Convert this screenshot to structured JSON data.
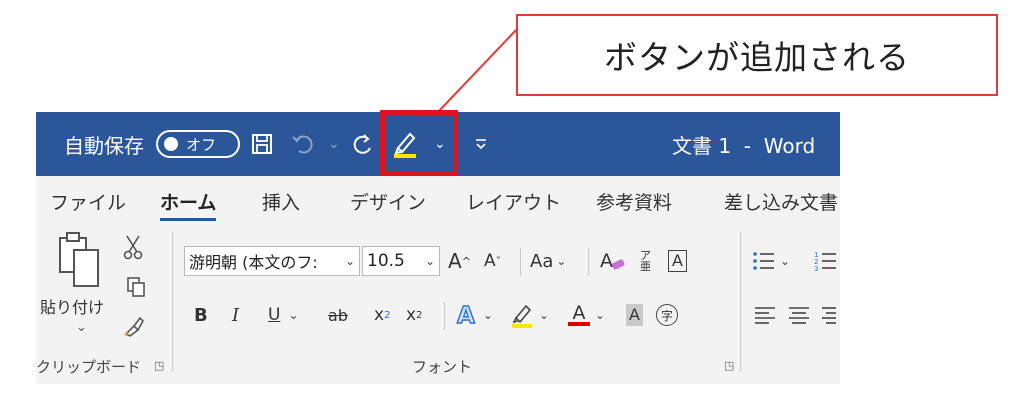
{
  "callout": {
    "text": "ボタンが追加される"
  },
  "titlebar": {
    "autosave_label": "自動保存",
    "autosave_toggle": "オフ",
    "doc_title": "文書 1  -  Word",
    "highlight_color": "#ffe600"
  },
  "tabs": [
    {
      "label": "ファイル"
    },
    {
      "label": "ホーム"
    },
    {
      "label": "挿入"
    },
    {
      "label": "デザイン"
    },
    {
      "label": "レイアウト"
    },
    {
      "label": "参考資料"
    },
    {
      "label": "差し込み文書"
    }
  ],
  "clipboard": {
    "paste_label": "貼り付け",
    "group_label": "クリップボード"
  },
  "font": {
    "name": "游明朝 (本文のフ:",
    "size": "10.5",
    "grow": "A",
    "shrink": "A",
    "change_case": "Aa",
    "bold": "B",
    "italic": "I",
    "underline": "U",
    "strike": "ab",
    "subscript": "x",
    "superscript": "x",
    "font_color_letter": "A",
    "shading_letter": "A",
    "enclose": "字",
    "border_letter": "A",
    "group_label": "フォント"
  },
  "colors": {
    "title_bar": "#2b579a",
    "ribbon_bg": "#f3f3f3",
    "callout_border": "#e23a3a",
    "qat_highlight": "#e0141e",
    "font_color_bar": "#e00000",
    "highlight_bar": "#ffe600",
    "accent_blue": "#2b6fd6"
  }
}
